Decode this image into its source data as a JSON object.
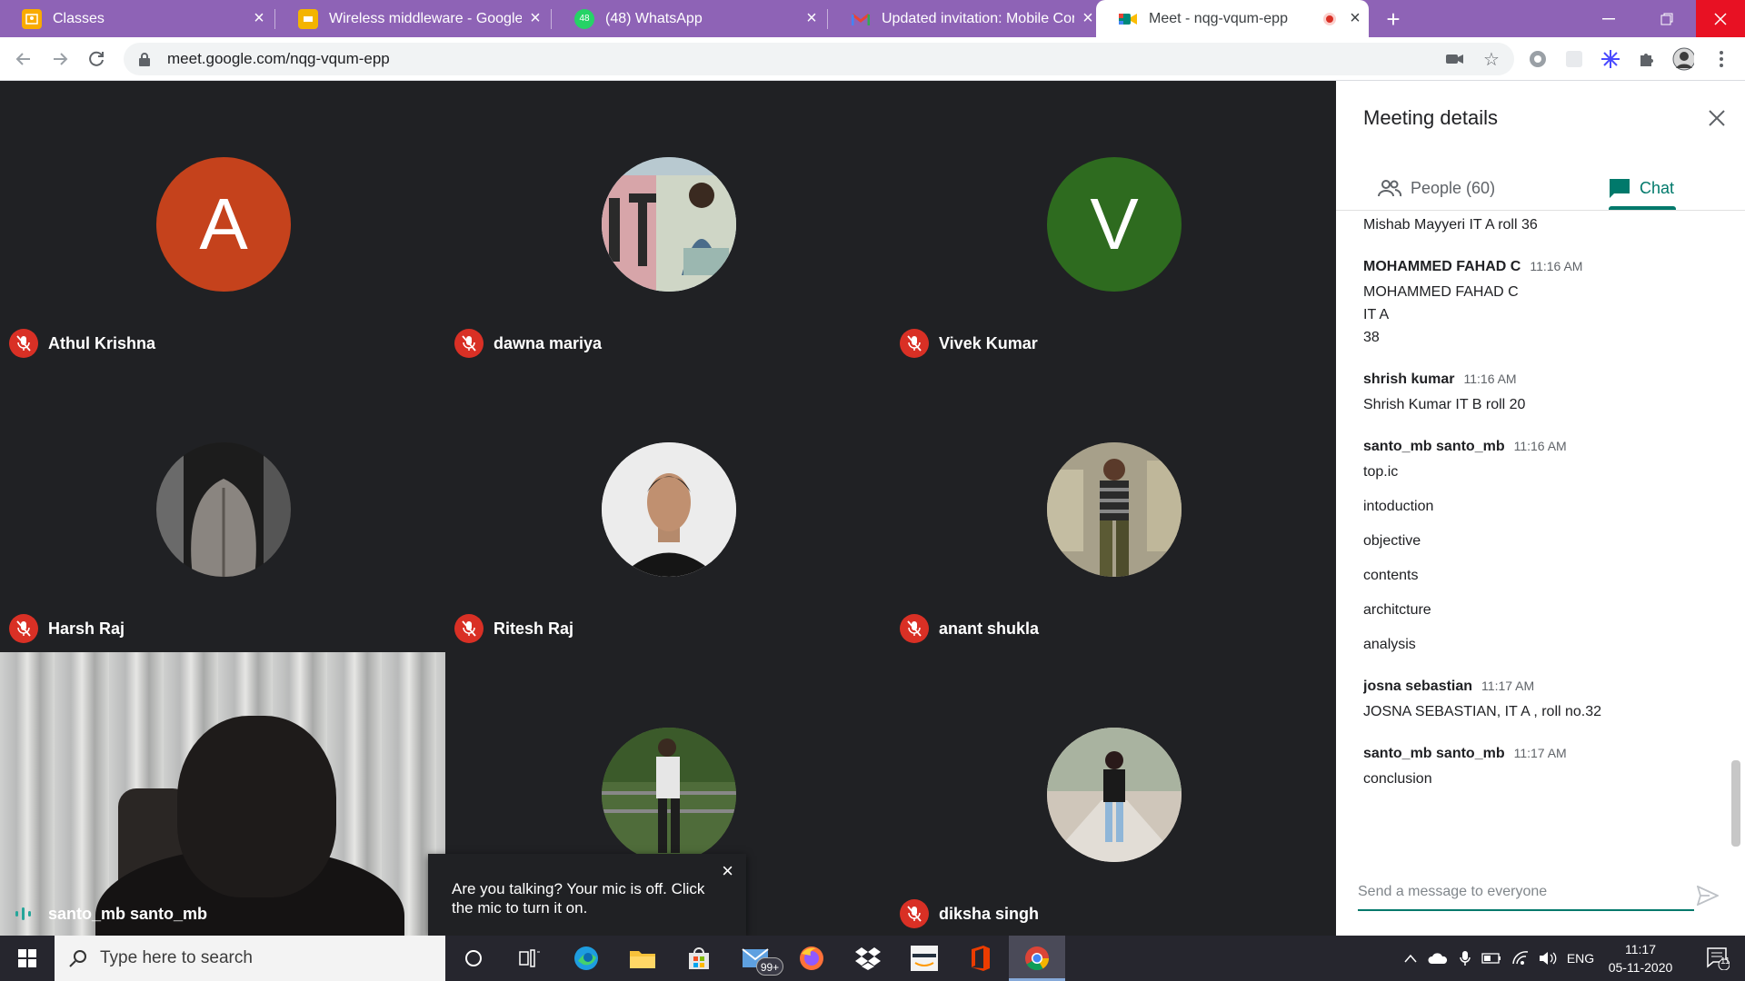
{
  "browser": {
    "tabs": [
      {
        "title": "Classes",
        "icon": "classroom-icon",
        "color": "#f9ab00"
      },
      {
        "title": "Wireless middleware - Google Sli",
        "icon": "slides-icon",
        "color": "#f4b400"
      },
      {
        "title": "(48) WhatsApp",
        "icon": "whatsapp-icon",
        "color": "#25d366"
      },
      {
        "title": "Updated invitation: Mobile Comp",
        "icon": "gmail-icon",
        "color": "#ea4335"
      },
      {
        "title": "Meet - nqg-vqum-epp",
        "icon": "meet-icon",
        "color": "#00897b"
      }
    ],
    "whatsapp_badge": "48",
    "url": "meet.google.com/nqg-vqum-epp"
  },
  "meet": {
    "participants": [
      {
        "name": "Athul Krishna",
        "initial": "A",
        "avatar_color": "#c5421c"
      },
      {
        "name": "dawna mariya",
        "initial": "",
        "avatar_color": "#9fb7c6"
      },
      {
        "name": "Vivek Kumar",
        "initial": "V",
        "avatar_color": "#2e6b1f"
      },
      {
        "name": "Harsh Raj",
        "initial": "",
        "avatar_color": "#2b2b2b"
      },
      {
        "name": "Ritesh Raj",
        "initial": "",
        "avatar_color": "#e8e8e8"
      },
      {
        "name": "anant shukla",
        "initial": "",
        "avatar_color": "#8b8a7a"
      },
      {
        "name": "diksha singh",
        "initial": "",
        "avatar_color": "#b9b0a6"
      },
      {
        "name": "",
        "initial": "",
        "avatar_color": "#5c7a45"
      }
    ],
    "self_name": "santo_mb santo_mb",
    "toast": {
      "text": "Are you talking? Your mic is off. Click the mic to turn it on."
    }
  },
  "panel": {
    "title": "Meeting details",
    "people_tab": "People (60)",
    "chat_tab": "Chat",
    "messages": [
      {
        "sender": "",
        "time": "",
        "lines": [
          "Mishab Mayyeri IT A roll 36"
        ]
      },
      {
        "sender": "MOHAMMED FAHAD C",
        "time": "11:16 AM",
        "lines": [
          "MOHAMMED FAHAD C",
          "IT A",
          "38"
        ]
      },
      {
        "sender": "shrish kumar",
        "time": "11:16 AM",
        "lines": [
          "Shrish Kumar IT B roll 20"
        ]
      },
      {
        "sender": "santo_mb santo_mb",
        "time": "11:16 AM",
        "lines": [
          "top.ic",
          "intoduction",
          "objective",
          "contents",
          "architcture",
          "analysis"
        ]
      },
      {
        "sender": "josna sebastian",
        "time": "11:17 AM",
        "lines": [
          "JOSNA SEBASTIAN, IT A , roll no.32"
        ]
      },
      {
        "sender": "santo_mb santo_mb",
        "time": "11:17 AM",
        "lines": [
          "conclusion"
        ]
      }
    ],
    "compose_placeholder": "Send a message to everyone"
  },
  "taskbar": {
    "search_placeholder": "Type here to search",
    "mail_badge": "99+",
    "language": "ENG",
    "time": "11:17",
    "date": "05-11-2020",
    "notification_count": "11"
  }
}
